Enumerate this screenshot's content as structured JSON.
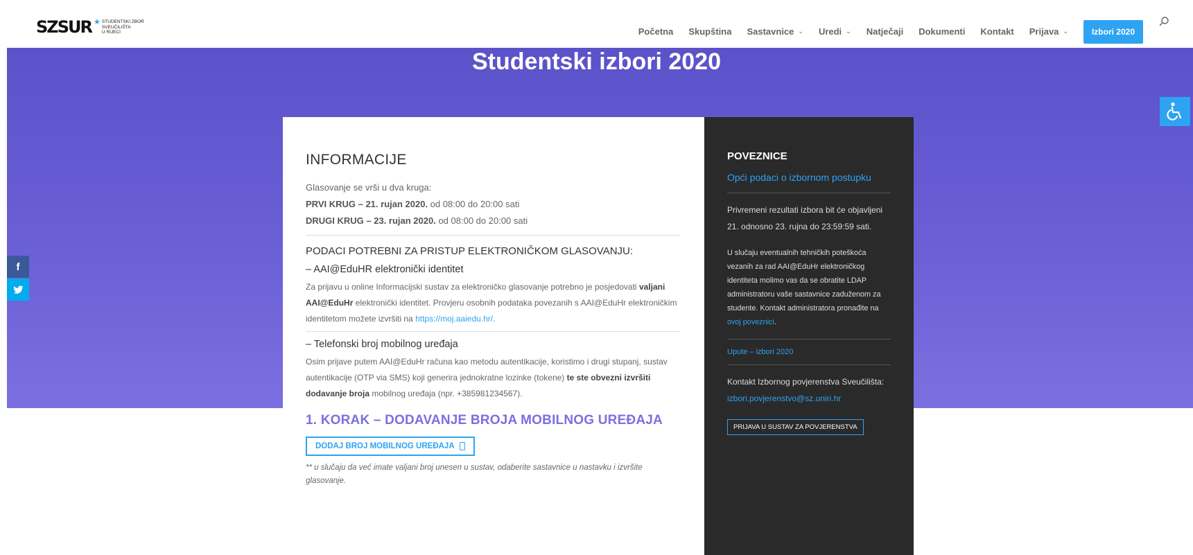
{
  "logo": {
    "mark": "SZSUR",
    "lines": [
      "STUDENTSKI ZBOR",
      "SVEUČILIŠTA",
      "U RIJECI"
    ]
  },
  "nav": {
    "items": [
      {
        "label": "Početna",
        "dropdown": false
      },
      {
        "label": "Skupština",
        "dropdown": false
      },
      {
        "label": "Sastavnice",
        "dropdown": true
      },
      {
        "label": "Uredi",
        "dropdown": true
      },
      {
        "label": "Natječaji",
        "dropdown": false
      },
      {
        "label": "Dokumenti",
        "dropdown": false
      },
      {
        "label": "Kontakt",
        "dropdown": false
      },
      {
        "label": "Prijava",
        "dropdown": true
      }
    ],
    "cta": "Izbori 2020",
    "search_icon": "search-icon"
  },
  "hero": {
    "title": "Studentski izbori 2020"
  },
  "social": {
    "facebook": "f",
    "twitter": "t"
  },
  "main": {
    "heading": "INFORMACIJE",
    "intro": "Glasovanje se vrši u dva kruga:",
    "round1_bold": "PRVI KRUG – 21. rujan 2020.",
    "round1_rest": " od 08:00 do 20:00 sati",
    "round2_bold": "DRUGI KRUG – 23. rujan 2020.",
    "round2_rest": " od 08:00 do 20:00 sati",
    "access_heading": "PODACI POTREBNI ZA PRISTUP ELEKTRONIČKOM GLASOVANJU:",
    "item1_title": "– AAI@EduHR elektronički identitet",
    "item1_a": "Za prijavu u online Informacijski sustav za elektroničko glasovanje potrebno je posjedovati ",
    "item1_b": "valjani AAI@EduHr",
    "item1_c": " elektronički identitet. Provjeru osobnih podataka povezanih s AAI@EduHr elektroničkim identitetom možete izvršiti na ",
    "item1_link": "https://moj.aaiedu.hr/",
    "item1_d": ".",
    "item2_title": "– Telefonski broj mobilnog uređaja",
    "item2_a": "Osim prijave putem AAI@EduHr računa kao metodu autentikacije, koristimo i drugi stupanj, sustav autentikacije (OTP via SMS) koji generira jednokratne lozinke (tokene) ",
    "item2_b": "te ste obvezni izvršiti dodavanje broja",
    "item2_c": " mobilnog uređaja (npr. +385981234567).",
    "step_heading": "1. KORAK – DODAVANJE BROJA MOBILNOG UREĐAJA",
    "step_button": "DODAJ BROJ MOBILNOG UREĐAJA",
    "note": "** u slučaju da već imate valjani broj unesen u sustav, odaberite sastavnice u nastavku i izvršite glasovanje."
  },
  "sidebar": {
    "heading": "POVEZNICE",
    "link1": "Opći podaci o izbornom postupku",
    "results": "Privremeni rezultati izbora bit će objavljeni 21. odnosno 23. rujna do 23:59:59 sati.",
    "tech_a": "U slučaju eventualnih tehničkih poteškoća vezanih za rad AAI@EduHr elektroničkog identiteta molimo vas da se obratite LDAP administratoru vaše sastavnice zaduženom za studente. Kontakt administratora pronađite na ",
    "tech_link": "ovoj poveznici",
    "tech_b": ".",
    "upute": "Upute – izbori 2020",
    "contact_label": "Kontakt Izbornog povjerenstva Sveučilišta:",
    "contact_email": "izbori.povjerenstvo@sz.uniri.hr",
    "button": "PRIJAVA U SUSTAV ZA POVJERENSTVA"
  },
  "colors": {
    "accent": "#2ea3f2",
    "hero_start": "#5b52c9",
    "hero_end": "#7b6fe0",
    "step_heading": "#7b6fe0",
    "sidebar_bg": "#2a2a2a"
  }
}
